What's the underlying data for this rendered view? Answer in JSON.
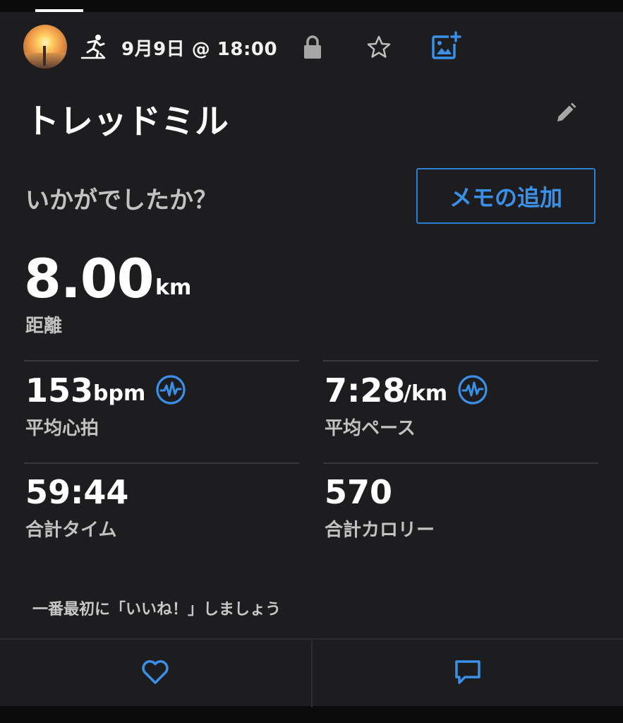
{
  "header": {
    "date_time": "9月9日 @ 18:00",
    "icons": {
      "activity": "treadmill-runner-icon",
      "privacy": "lock-icon",
      "favorite": "star-icon",
      "add_photo": "add-photo-icon"
    }
  },
  "activity": {
    "title": "トレッドミル",
    "edit_icon": "pencil-icon"
  },
  "feedback": {
    "question": "いかがでしたか？",
    "memo_button_label": "メモの追加"
  },
  "distance": {
    "value": "8.00",
    "unit": "km",
    "label": "距離"
  },
  "stats": [
    {
      "value": "153",
      "unit": "bpm",
      "label": "平均心拍",
      "has_chart_icon": true
    },
    {
      "value": "7:28",
      "unit": "/km",
      "label": "平均ペース",
      "has_chart_icon": true
    },
    {
      "value": "59:44",
      "unit": "",
      "label": "合計タイム",
      "has_chart_icon": false
    },
    {
      "value": "570",
      "unit": "",
      "label": "合計カロリー",
      "has_chart_icon": false
    }
  ],
  "social": {
    "like_prompt": "一番最初に「いいね！」しましょう",
    "like_icon": "heart-icon",
    "comment_icon": "comment-icon"
  },
  "colors": {
    "accent": "#3a8fe8",
    "background": "#1d1d1f",
    "outer": "#0b0b0b",
    "label": "#c2c2c2",
    "divider": "#3a3a3c"
  }
}
